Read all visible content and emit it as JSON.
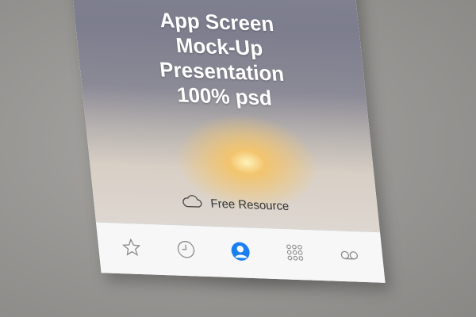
{
  "mockup": {
    "title_lines": [
      "App Screen",
      "Mock-Up",
      "Presentation",
      "100% psd"
    ],
    "resource_label": "Free Resource",
    "resource_icon": "cloud-icon"
  },
  "tabbar": {
    "items": [
      {
        "icon": "star-icon",
        "active": false
      },
      {
        "icon": "clock-icon",
        "active": false
      },
      {
        "icon": "person-icon",
        "active": true
      },
      {
        "icon": "keypad-icon",
        "active": false
      },
      {
        "icon": "voicemail-icon",
        "active": false
      }
    ]
  },
  "colors": {
    "accent": "#1a7ff0",
    "icon": "#8a8a8a",
    "tabbar_bg": "#f7f7f7"
  }
}
